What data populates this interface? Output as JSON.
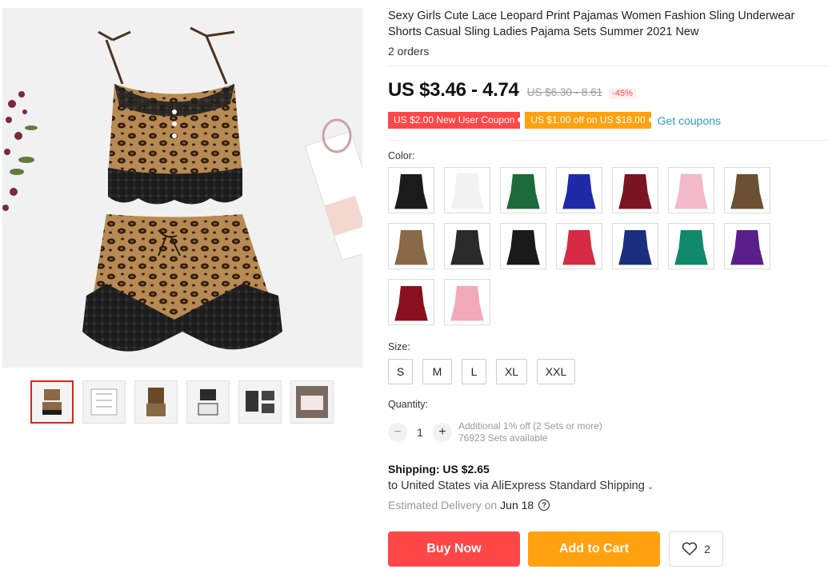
{
  "product": {
    "title": "Sexy Girls Cute Lace Leopard Print Pajamas Women Fashion Sling Underwear Shorts Casual Sling Ladies Pajama Sets Summer 2021 New",
    "orders": "2 orders"
  },
  "price": {
    "current": "US $3.46 - 4.74",
    "original": "US $6.30 - 8.61",
    "discount": "-45%"
  },
  "coupons": {
    "new_user": "US $2.00 New User Coupon",
    "off": "US $1.00 off on US $18.00",
    "get": "Get coupons"
  },
  "color": {
    "label": "Color:",
    "swatches": [
      {
        "name": "black",
        "color": "#1b1b1b"
      },
      {
        "name": "white",
        "color": "#f2f2f2"
      },
      {
        "name": "green",
        "color": "#1d6b3a"
      },
      {
        "name": "blue",
        "color": "#1f2aa8"
      },
      {
        "name": "wine",
        "color": "#7a1526"
      },
      {
        "name": "pink",
        "color": "#f4b9c9"
      },
      {
        "name": "leopard-black",
        "color": "#6b5034"
      },
      {
        "name": "leopard-lace",
        "color": "#8a6a46"
      },
      {
        "name": "black-white-lace",
        "color": "#2a2a2a"
      },
      {
        "name": "satin-black",
        "color": "#1a1a1a"
      },
      {
        "name": "satin-red",
        "color": "#d62a45"
      },
      {
        "name": "satin-navy",
        "color": "#1a2f7e"
      },
      {
        "name": "satin-teal",
        "color": "#11896b"
      },
      {
        "name": "satin-purple",
        "color": "#5b1f8a"
      },
      {
        "name": "satin-burgundy",
        "color": "#8a1020"
      },
      {
        "name": "satin-pink",
        "color": "#f2aab8"
      }
    ]
  },
  "size": {
    "label": "Size:",
    "options": [
      "S",
      "M",
      "L",
      "XL",
      "XXL"
    ]
  },
  "quantity": {
    "label": "Quantity:",
    "value": "1",
    "minus": "−",
    "plus": "+",
    "note1": "Additional 1% off (2 Sets or more)",
    "note2": "76923 Sets available"
  },
  "shipping": {
    "title_bold": "Shipping: US $2.65",
    "line": "to United States via AliExpress Standard Shipping",
    "chevron": "⌄",
    "estimated": "Estimated Delivery on",
    "date": "Jun 18",
    "help": "?"
  },
  "actions": {
    "buy": "Buy Now",
    "cart": "Add to Cart",
    "wish_count": "2"
  },
  "colors": {
    "accent_red": "#ff4747",
    "accent_orange": "#ffa20f",
    "link": "#2e9cc3"
  }
}
